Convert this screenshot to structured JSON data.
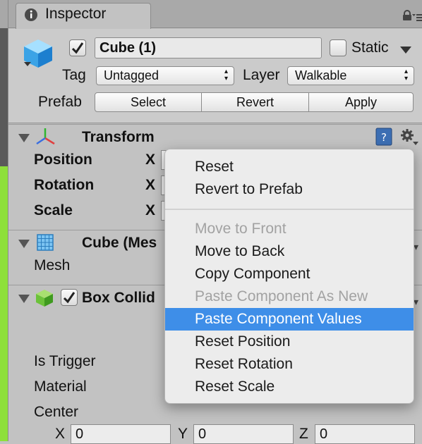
{
  "tab": {
    "title": "Inspector",
    "icon": "info-icon"
  },
  "header": {
    "object_name": "Cube (1)",
    "static_label": "Static",
    "tag_label": "Tag",
    "tag_value": "Untagged",
    "layer_label": "Layer",
    "layer_value": "Walkable",
    "prefab_label": "Prefab",
    "prefab_buttons": [
      "Select",
      "Revert",
      "Apply"
    ],
    "active_checked": true,
    "static_checked": false
  },
  "transform": {
    "title": "Transform",
    "rows": [
      {
        "label": "Position",
        "axis": "X"
      },
      {
        "label": "Rotation",
        "axis": "X"
      },
      {
        "label": "Scale",
        "axis": "X"
      }
    ]
  },
  "mesh_filter": {
    "title": "Cube (Mes",
    "field_label": "Mesh"
  },
  "box_collider": {
    "title": "Box Collid",
    "enabled": true,
    "fields": [
      "Is Trigger",
      "Material",
      "Center"
    ],
    "center": [
      {
        "axis": "X",
        "value": "0"
      },
      {
        "axis": "Y",
        "value": "0"
      },
      {
        "axis": "Z",
        "value": "0"
      }
    ]
  },
  "context_menu": {
    "items": [
      {
        "label": "Reset",
        "state": "enabled"
      },
      {
        "label": "Revert to Prefab",
        "state": "enabled"
      },
      {
        "label": "Move to Front",
        "state": "disabled"
      },
      {
        "label": "Move to Back",
        "state": "enabled"
      },
      {
        "label": "Copy Component",
        "state": "enabled"
      },
      {
        "label": "Paste Component As New",
        "state": "disabled"
      },
      {
        "label": "Paste Component Values",
        "state": "selected"
      },
      {
        "label": "Reset Position",
        "state": "enabled"
      },
      {
        "label": "Reset Rotation",
        "state": "enabled"
      },
      {
        "label": "Reset Scale",
        "state": "enabled"
      }
    ]
  },
  "colors": {
    "selection": "#3e8ee8",
    "panel": "#c2c2c2",
    "green_strip": "#8ee03a"
  }
}
